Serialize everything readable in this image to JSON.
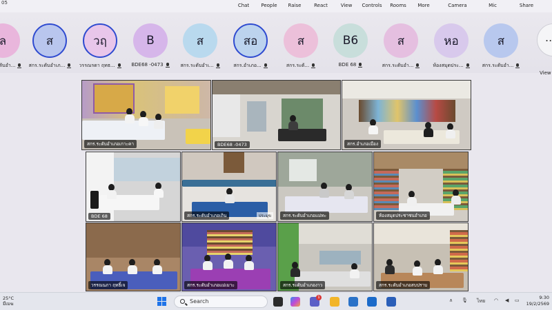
{
  "toolbar": {
    "corner_text": "05",
    "buttons": {
      "chat": "Chat",
      "people": "People",
      "raise": "Raise",
      "react": "React",
      "view": "View",
      "controls": "Controls",
      "rooms": "Rooms",
      "more": "More",
      "camera": "Camera",
      "mic": "Mic",
      "share": "Share"
    }
  },
  "participants": [
    {
      "initials": "ล",
      "name": "สกร.ระดับอำ...",
      "color": "#e9b6dc",
      "ring": false,
      "mic": "on"
    },
    {
      "initials": "ส",
      "name": "สกร.ระดับอำเภ...",
      "color": "#b9c6ee",
      "ring": true,
      "mic": "on"
    },
    {
      "initials": "วฤ",
      "name": "วรรณรดา ฤทธ...",
      "color": "#e8c6ea",
      "ring": true,
      "mic": "on"
    },
    {
      "initials": "B",
      "name": "BDE68 -0473",
      "color": "#d6b6ea",
      "ring": false,
      "mic": "on"
    },
    {
      "initials": "ส",
      "name": "สกร.ระดับอำเ...",
      "color": "#b9d9ee",
      "ring": false,
      "mic": "on"
    },
    {
      "initials": "สอ",
      "name": "สกร.อำเภอ...",
      "color": "#bcd3ee",
      "ring": true,
      "mic": "on"
    },
    {
      "initials": "ส",
      "name": "สกร.ระดั...",
      "color": "#ecc0da",
      "ring": false,
      "mic": "muted"
    },
    {
      "initials": "B6",
      "name": "BDE 68",
      "color": "#c8dedb",
      "ring": false,
      "mic": "on"
    },
    {
      "initials": "ส",
      "name": "สกร.ระดับอำ...",
      "color": "#e5bfe0",
      "ring": false,
      "mic": "on"
    },
    {
      "initials": "หอ",
      "name": "ห้องสมุดประ...",
      "color": "#d8c9ec",
      "ring": false,
      "mic": "on"
    },
    {
      "initials": "ส",
      "name": "สกร.ระดับอำ...",
      "color": "#b8c8ee",
      "ring": false,
      "mic": "on"
    }
  ],
  "more_participants": {
    "icon": "...",
    "label": "View"
  },
  "tiles": [
    {
      "label": "สกร.ระดับอำเภอเกาะคา",
      "extra": ""
    },
    {
      "label": "BDE68 -0473",
      "extra": ""
    },
    {
      "label": "สกร.อำเภอเมือง",
      "extra": ""
    },
    {
      "label": "BDE 68",
      "extra": ""
    },
    {
      "label": "สกร.ระดับอำเภอเถิน",
      "extra": "ประมุข"
    },
    {
      "label": "สกร.ระดับอำเภอแม่ทะ",
      "extra": ""
    },
    {
      "label": "ห้องสมุดประชาชนอำเภอ",
      "extra": ""
    },
    {
      "label": "วรรณนภา ฤทธิ์เจ",
      "extra": ""
    },
    {
      "label": "สกร.ระดับอำเภอแม่เมาะ",
      "extra": ""
    },
    {
      "label": "สกร.ระดับอำเภองาว",
      "extra": ""
    },
    {
      "label": "สกร.ระดับอำเภอสบปราบ",
      "extra": ""
    }
  ],
  "taskbar": {
    "weather_temp": "25°C",
    "weather_text": "มีเมฆ",
    "search_placeholder": "Search",
    "notification_count": "1",
    "lang": "ไทย",
    "time": "9:30",
    "date": "19/2/2569"
  }
}
